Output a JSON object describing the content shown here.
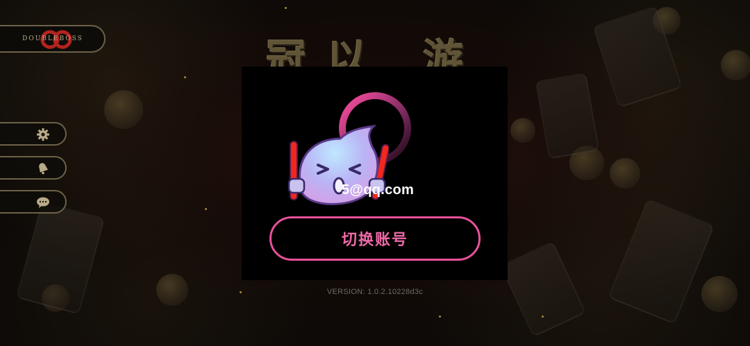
{
  "logo": {
    "text": "DOUBLEBOSS"
  },
  "game_title": "冠以 游戏",
  "sidebar": {
    "items": [
      {
        "icon": "gear-icon"
      },
      {
        "icon": "bell-icon"
      },
      {
        "icon": "chat-icon"
      }
    ]
  },
  "account_dialog": {
    "email": "5@qq.com",
    "switch_account_label": "切换账号",
    "accent_color": "#e8519a"
  },
  "version": "VERSION: 1.0.2.10228d3c"
}
